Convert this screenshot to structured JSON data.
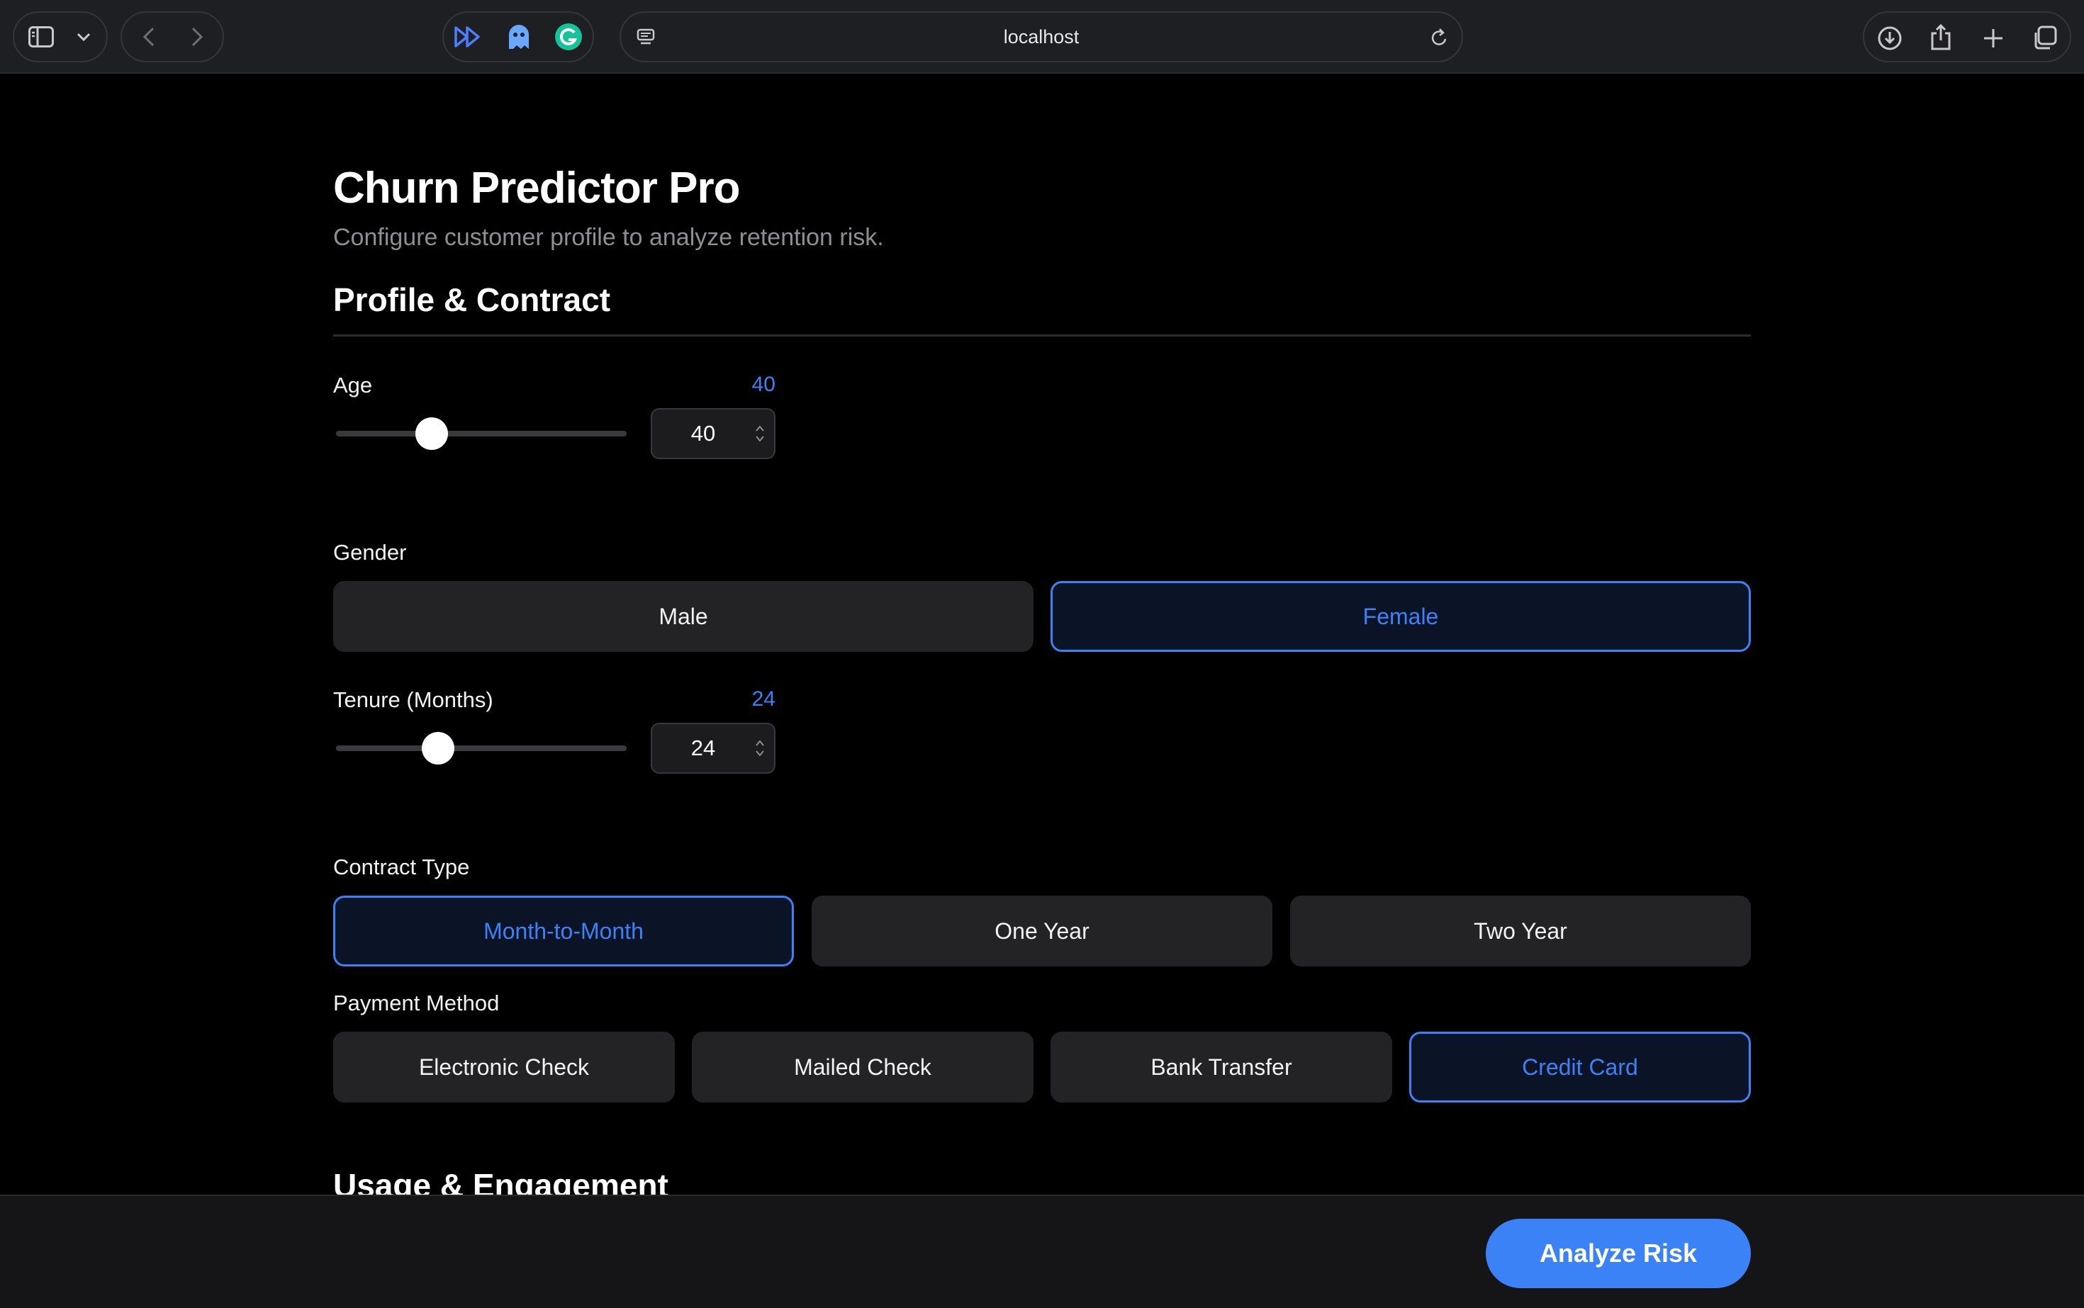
{
  "browser": {
    "address": "localhost"
  },
  "app": {
    "title": "Churn Predictor Pro",
    "subtitle": "Configure customer profile to analyze retention risk."
  },
  "sections": {
    "profile": {
      "title": "Profile & Contract"
    },
    "usage": {
      "title": "Usage & Engagement"
    }
  },
  "age": {
    "label": "Age",
    "value": "40",
    "input_value": "40",
    "slider_fraction": 0.33
  },
  "gender": {
    "label": "Gender",
    "options": [
      "Male",
      "Female"
    ],
    "selected": "Female"
  },
  "tenure": {
    "label": "Tenure (Months)",
    "value": "24",
    "input_value": "24",
    "slider_fraction": 0.35
  },
  "contract": {
    "label": "Contract Type",
    "options": [
      "Month-to-Month",
      "One Year",
      "Two Year"
    ],
    "selected": "Month-to-Month"
  },
  "payment": {
    "label": "Payment Method",
    "options": [
      "Electronic Check",
      "Mailed Check",
      "Bank Transfer",
      "Credit Card"
    ],
    "selected": "Credit Card"
  },
  "footer": {
    "analyze_label": "Analyze Risk"
  },
  "colors": {
    "accent": "#3b82f6",
    "background": "#000000",
    "option_bg": "#232325"
  }
}
